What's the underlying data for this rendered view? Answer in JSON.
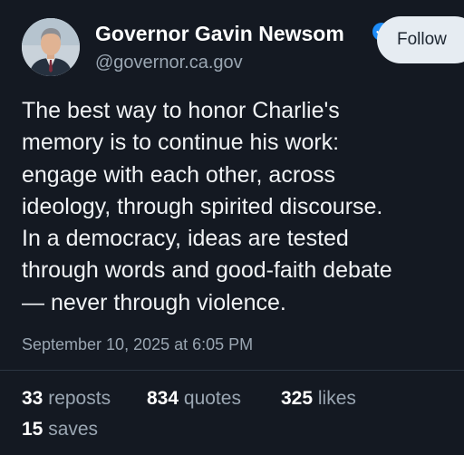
{
  "author": {
    "display_name": "Governor Gavin Newsom",
    "handle": "@governor.ca.gov",
    "verified_icon": "verified-check-icon",
    "badge_color": "#1d8cf8"
  },
  "follow_button": {
    "label": "Follow"
  },
  "post": {
    "lines": [
      "The best way to honor Charlie's",
      "memory is to continue his work:",
      "engage with each other, across",
      "ideology, through spirited discourse.",
      "In a democracy, ideas are tested",
      "through words and good-faith debate",
      "— never through violence."
    ],
    "timestamp": "September 10, 2025 at 6:05 PM"
  },
  "stats": {
    "reposts": {
      "count": "33",
      "label": "reposts"
    },
    "quotes": {
      "count": "834",
      "label": "quotes"
    },
    "likes": {
      "count": "325",
      "label": "likes"
    },
    "saves": {
      "count": "15",
      "label": "saves"
    }
  },
  "colors": {
    "background": "#141922",
    "text_primary": "#f1f3f5",
    "text_secondary": "#9aa6b2",
    "button_bg": "#e6ecf2"
  }
}
